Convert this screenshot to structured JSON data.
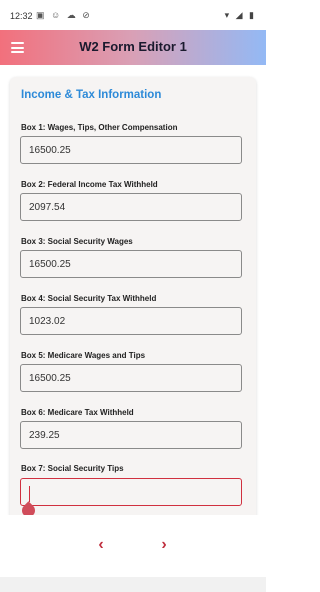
{
  "status": {
    "time": "12:32",
    "left_icons": "▣ ☺ ☁ ⊘",
    "right_icons": "▾ ◢ ▮"
  },
  "app_bar": {
    "title": "W2 Form Editor 1"
  },
  "form": {
    "section_title": "Income & Tax Information",
    "fields": [
      {
        "label": "Box 1: Wages, Tips, Other Compensation",
        "value": "16500.25"
      },
      {
        "label": "Box 2: Federal Income Tax Withheld",
        "value": "2097.54"
      },
      {
        "label": "Box 3: Social Security Wages",
        "value": "16500.25"
      },
      {
        "label": "Box 4: Social Security Tax Withheld",
        "value": "1023.02"
      },
      {
        "label": "Box 5: Medicare Wages and Tips",
        "value": "16500.25"
      },
      {
        "label": "Box 6: Medicare Tax Withheld",
        "value": "239.25"
      },
      {
        "label": "Box 7: Social Security Tips",
        "value": ""
      }
    ]
  },
  "nav": {
    "prev_icon": "‹",
    "next_icon": "›"
  },
  "colors": {
    "accent": "#2d8ad8",
    "error": "#d0303f",
    "app_bar_start": "#f2707c",
    "app_bar_end": "#93b9f5"
  }
}
